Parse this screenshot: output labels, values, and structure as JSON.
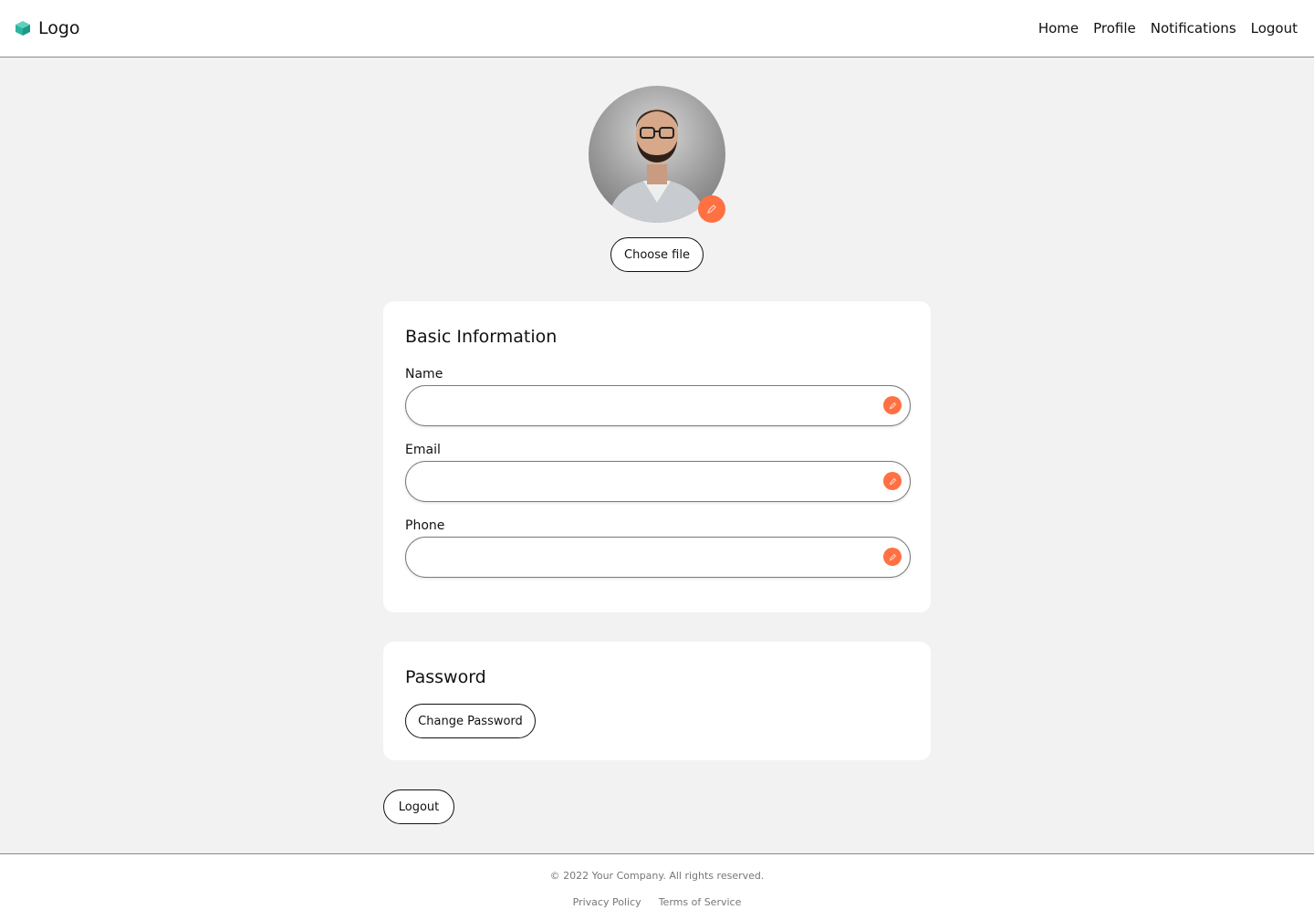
{
  "header": {
    "logo_label": "Logo",
    "logo_icon": "cube-icon",
    "brand_color": "#2bb5a0",
    "nav": [
      {
        "label": "Home"
      },
      {
        "label": "Profile"
      },
      {
        "label": "Notifications"
      },
      {
        "label": "Logout"
      }
    ]
  },
  "profile": {
    "avatar": "avatar-photo-man-with-glasses",
    "edit_icon": "pencil-icon",
    "accent_color": "#ff7043",
    "choose_file_label": "Choose file"
  },
  "basic_info": {
    "title": "Basic Information",
    "fields": [
      {
        "label": "Name",
        "value": "",
        "placeholder": ""
      },
      {
        "label": "Email",
        "value": "",
        "placeholder": ""
      },
      {
        "label": "Phone",
        "value": "",
        "placeholder": ""
      }
    ]
  },
  "password": {
    "title": "Password",
    "change_label": "Change Password"
  },
  "logout_label": "Logout",
  "footer": {
    "copyright": "© 2022 Your Company. All rights reserved.",
    "links": [
      {
        "label": "Privacy Policy"
      },
      {
        "label": "Terms of Service"
      }
    ]
  }
}
